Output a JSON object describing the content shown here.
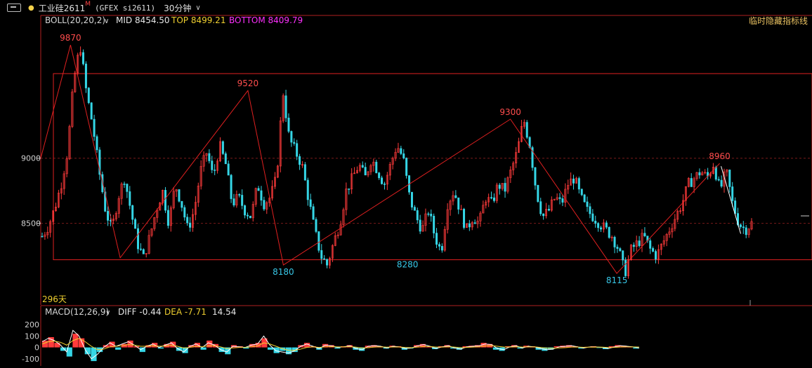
{
  "window": {
    "symbol": "工业硅2611",
    "badge": "M",
    "exchange_code": "(GFEX si2611)",
    "period": "30分钟"
  },
  "boll": {
    "label": "BOLL(20,20,2)",
    "mid": "MID 8454.50",
    "top": "TOP 8499.21",
    "bottom": "BOTTOM 8409.79"
  },
  "hide_indicator": "临时隐藏指标线",
  "duration": "296天",
  "macd": {
    "label": "MACD(12,26,9)",
    "diff": "DIFF -0.44",
    "dea": "DEA -7.71",
    "macd": "14.54"
  },
  "colors": {
    "up": "#ff3b3b",
    "down": "#35d6e6",
    "frame": "#e02020",
    "label_high": "#ff4d4d",
    "label_low": "#38c8e8",
    "diff_line": "#ffffff",
    "dea_line": "#f0d030",
    "top_text": "#f0d030",
    "bottom_text": "#ff30ff"
  },
  "chart_data": {
    "type": "line",
    "y_ticks": [
      9000,
      8500
    ],
    "ylim": [
      7900,
      10000
    ],
    "zigzag": [
      {
        "label": "9870",
        "y": 9870,
        "kind": "high"
      },
      {
        "label": "",
        "y": 8235,
        "kind": "low"
      },
      {
        "label": "9520",
        "y": 9520,
        "kind": "high"
      },
      {
        "label": "8180",
        "y": 8180,
        "kind": "low"
      },
      {
        "label": "9300",
        "y": 9300,
        "kind": "high"
      },
      {
        "label": "8115",
        "y": 8115,
        "kind": "low"
      },
      {
        "label": "8960",
        "y": 8960,
        "kind": "high"
      }
    ],
    "other_labels": [
      {
        "label": "8280",
        "y": 8280
      }
    ],
    "range_box": {
      "top": 9650,
      "bottom": 8220
    },
    "price_path": [
      8400,
      8480,
      8620,
      8800,
      9050,
      9600,
      9870,
      9500,
      9250,
      8900,
      8600,
      8450,
      8700,
      8850,
      8600,
      8350,
      8235,
      8400,
      8600,
      8750,
      8500,
      8800,
      8650,
      8450,
      8600,
      8900,
      9050,
      8850,
      9100,
      8950,
      8650,
      8700,
      8600,
      8550,
      8800,
      8650,
      8700,
      8850,
      9520,
      9150,
      9050,
      8950,
      8700,
      8450,
      8250,
      8180,
      8350,
      8500,
      8750,
      8850,
      8950,
      8850,
      9000,
      8900,
      8800,
      8950,
      9100,
      9000,
      8700,
      8550,
      8450,
      8600,
      8400,
      8280,
      8650,
      8750,
      8600,
      8450,
      8550,
      8500,
      8700,
      8650,
      8800,
      8750,
      8900,
      9050,
      9300,
      9100,
      8750,
      8550,
      8600,
      8700,
      8650,
      8800,
      8850,
      8700,
      8600,
      8550,
      8500,
      8450,
      8400,
      8300,
      8115,
      8300,
      8350,
      8400,
      8300,
      8250,
      8350,
      8450,
      8550,
      8650,
      8800,
      8850,
      8900,
      8850,
      8960,
      8750,
      8900,
      8650,
      8500,
      8450,
      8500
    ],
    "macd_ticks": [
      200,
      100,
      0,
      -100
    ],
    "macd_ylim": [
      -150,
      250
    ],
    "macd_bars": [
      60,
      90,
      40,
      -30,
      -80,
      120,
      80,
      -60,
      -120,
      -40,
      20,
      50,
      -20,
      30,
      60,
      10,
      -40,
      20,
      40,
      -10,
      30,
      50,
      -30,
      -50,
      20,
      40,
      -20,
      60,
      30,
      -40,
      -60,
      20,
      10,
      -10,
      30,
      40,
      80,
      -20,
      -50,
      -30,
      -60,
      -40,
      20,
      40,
      10,
      -20,
      30,
      20,
      -10,
      10,
      20,
      -20,
      -30,
      15,
      20,
      10,
      -10,
      15,
      10,
      -20,
      -10,
      20,
      30,
      10,
      -15,
      10,
      20,
      -10,
      -20,
      10,
      15,
      20,
      40,
      30,
      -20,
      -30,
      10,
      20,
      -10,
      15,
      10,
      -20,
      -30,
      -20,
      10,
      15,
      20,
      10,
      -10,
      5,
      10,
      -5,
      -15,
      10,
      20,
      15,
      5,
      -10
    ],
    "diff": [
      50,
      80,
      60,
      20,
      -40,
      150,
      100,
      -20,
      -100,
      -60,
      0,
      40,
      10,
      30,
      50,
      20,
      -20,
      10,
      30,
      0,
      20,
      40,
      -10,
      -40,
      10,
      30,
      0,
      40,
      20,
      -20,
      -40,
      10,
      5,
      0,
      20,
      30,
      100,
      20,
      -30,
      -40,
      -50,
      -30,
      10,
      30,
      10,
      -10,
      20,
      15,
      0,
      5,
      15,
      -10,
      -20,
      10,
      15,
      10,
      -5,
      10,
      5,
      -10,
      -5,
      15,
      25,
      10,
      -10,
      5,
      15,
      -5,
      -15,
      5,
      10,
      15,
      30,
      25,
      -10,
      -20,
      5,
      15,
      -5,
      10,
      5,
      -10,
      -20,
      -15,
      5,
      10,
      15,
      5,
      -5,
      5,
      5,
      0,
      -10,
      5,
      15,
      10,
      5,
      -5
    ],
    "dea": [
      30,
      50,
      55,
      45,
      20,
      60,
      80,
      50,
      10,
      -20,
      -15,
      5,
      10,
      15,
      25,
      20,
      10,
      10,
      15,
      10,
      12,
      20,
      10,
      -5,
      0,
      10,
      5,
      15,
      15,
      5,
      -10,
      -5,
      0,
      0,
      5,
      12,
      40,
      30,
      10,
      -10,
      -25,
      -25,
      -15,
      0,
      5,
      0,
      5,
      8,
      5,
      5,
      8,
      2,
      -5,
      -2,
      3,
      5,
      2,
      4,
      4,
      0,
      -2,
      3,
      8,
      8,
      3,
      3,
      6,
      3,
      -2,
      0,
      3,
      6,
      12,
      16,
      10,
      3,
      3,
      6,
      3,
      5,
      5,
      0,
      -6,
      -8,
      -5,
      -2,
      3,
      3,
      1,
      2,
      3,
      2,
      -1,
      0,
      4,
      5,
      5,
      3
    ]
  }
}
